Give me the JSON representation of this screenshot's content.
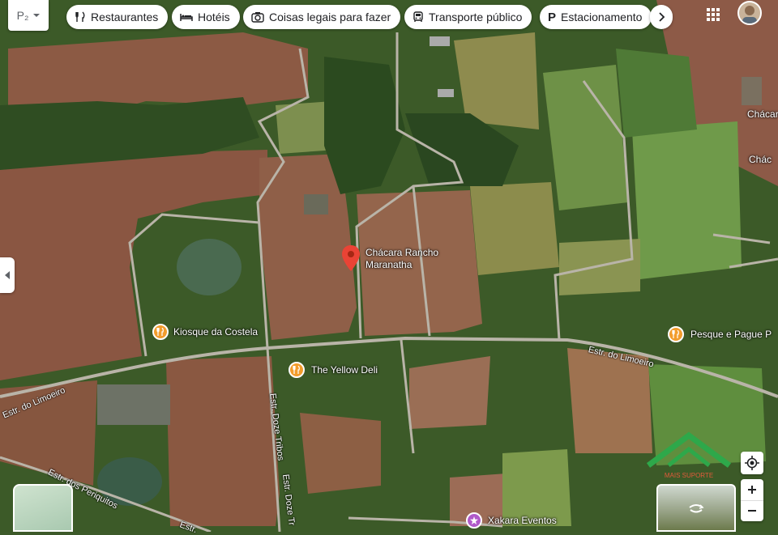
{
  "toolbar": {
    "app_logo": "P₂",
    "chips": [
      {
        "label": "Restaurantes",
        "icon": "fork-knife-icon"
      },
      {
        "label": "Hotéis",
        "icon": "bed-icon"
      },
      {
        "label": "Coisas legais para fazer",
        "icon": "camera-icon"
      },
      {
        "label": "Transporte público",
        "icon": "bus-icon"
      },
      {
        "label": "Estacionamento",
        "icon": "parking-icon"
      }
    ]
  },
  "map": {
    "view": "satellite",
    "marker": {
      "label_line1": "Chácara Rancho",
      "label_line2": "Maranatha",
      "color": "#ea4335"
    },
    "places": [
      {
        "name": "Kiosque da Costela",
        "type": "restaurant"
      },
      {
        "name": "The Yellow Deli",
        "type": "restaurant"
      },
      {
        "name": "Pesque e Pague P",
        "type": "restaurant"
      },
      {
        "name": "Xakara Eventos",
        "type": "venue"
      }
    ],
    "labels": {
      "chacara_a": "Chácara so",
      "chacara_b": "Chác"
    },
    "roads": {
      "limoeiro_west": "Estr. do Limoeiro",
      "limoeiro_east": "Estr. do Limoeiro",
      "doze_tribos_a": "Estr. Doze Tribos",
      "doze_tribos_b": "Estr. Doze Tr",
      "periquitos": "Estr. dos Periquitos",
      "south": "Estr."
    },
    "watermark": "MAIS SUPORTE"
  }
}
